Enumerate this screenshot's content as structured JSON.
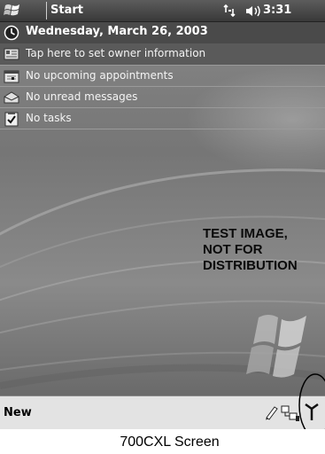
{
  "title_bar": {
    "title": "Start",
    "time": "3:31",
    "icons": [
      "windows-start-icon",
      "connectivity-icon",
      "volume-icon"
    ]
  },
  "today": {
    "date": "Wednesday, March 26, 2003",
    "owner": "Tap here to set owner information",
    "appointments": "No upcoming appointments",
    "messages": "No unread messages",
    "tasks": "No tasks",
    "row_icons": [
      "clock-icon",
      "owner-card-icon",
      "calendar-icon",
      "envelope-icon",
      "tasks-checkbox-icon"
    ]
  },
  "watermark": {
    "line1": "TEST IMAGE,",
    "line2": "NOT FOR",
    "line3": "DISTRIBUTION"
  },
  "menu_bar": {
    "new_label": "New",
    "tray_icons": [
      "pen-icon",
      "usb-connection-icon",
      "antenna-icon"
    ]
  },
  "caption": "700CXL Screen",
  "colors": {
    "title_bar": "#393939",
    "today_background": "#7a7a7a",
    "menu_bar": "#e3e3e3"
  }
}
